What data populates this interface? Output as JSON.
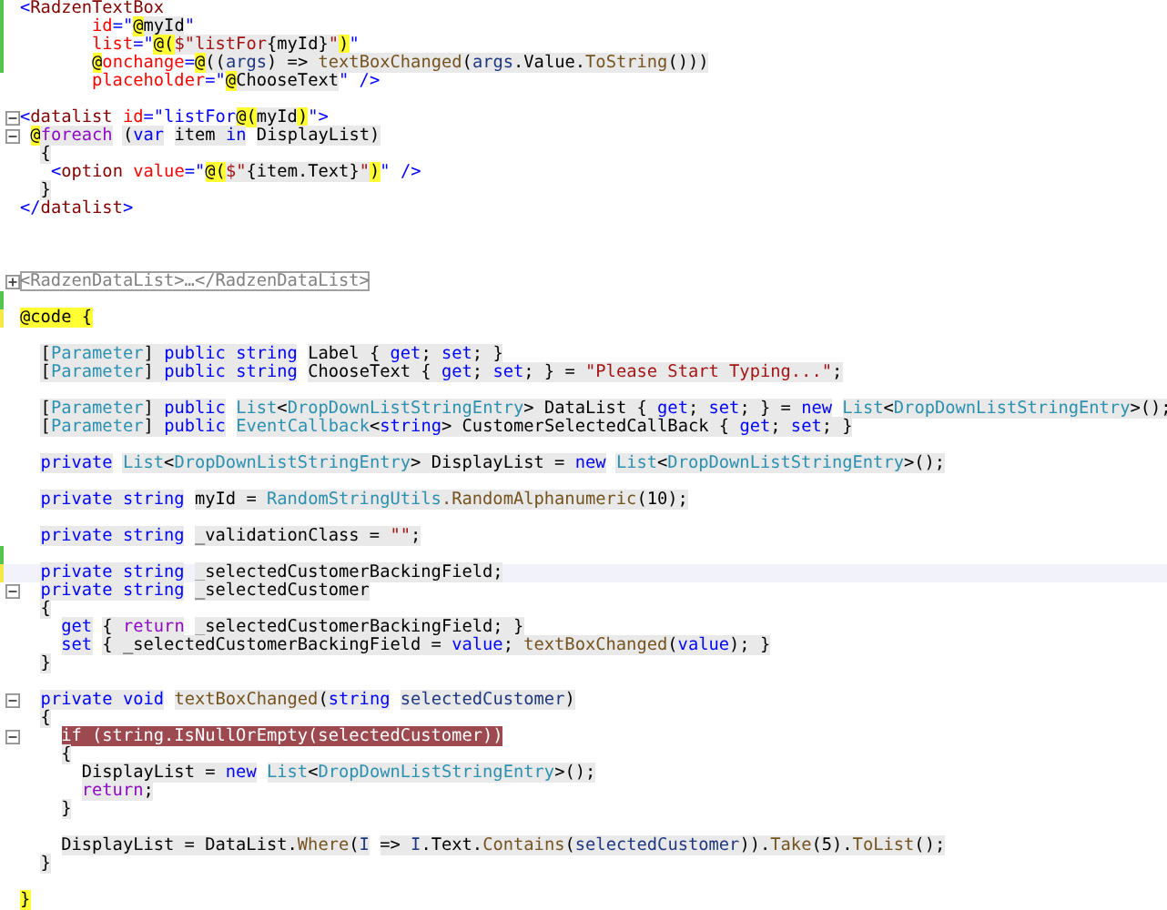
{
  "editor": {
    "lines": [
      {
        "modified": true,
        "saved": true,
        "tokens": [
          {
            "kind": "punct",
            "text": "<"
          },
          {
            "kind": "tag",
            "text": "RadzenTextBox"
          }
        ]
      },
      {
        "modified": true,
        "saved": true,
        "tokens": [
          {
            "kind": "attr",
            "text": "       id"
          },
          {
            "kind": "punct",
            "text": "=\""
          },
          {
            "kind": "razor",
            "text": "@"
          },
          {
            "kind": "plain",
            "text": "myId",
            "shaded": true
          },
          {
            "kind": "punct",
            "text": "\""
          }
        ]
      },
      {
        "modified": true,
        "saved": true,
        "tokens": [
          {
            "kind": "attr",
            "text": "       list"
          },
          {
            "kind": "punct",
            "text": "=\""
          },
          {
            "kind": "razor",
            "text": "@("
          },
          {
            "kind": "str",
            "text": "$\"listFor",
            "shaded": true
          },
          {
            "kind": "plain",
            "text": "{myId}",
            "shaded": true
          },
          {
            "kind": "str",
            "text": "\"",
            "shaded": true
          },
          {
            "kind": "razor",
            "text": ")"
          },
          {
            "kind": "punct",
            "text": "\""
          }
        ]
      },
      {
        "modified": true,
        "saved": true,
        "tokens": [
          {
            "kind": "razor",
            "text": "       @"
          },
          {
            "kind": "attr",
            "text": "onchange"
          },
          {
            "kind": "punct",
            "text": "="
          },
          {
            "kind": "razor",
            "text": "@"
          },
          {
            "kind": "plain",
            "text": "((",
            "shaded": true
          },
          {
            "kind": "param",
            "text": "args",
            "shaded": true
          },
          {
            "kind": "plain",
            "text": ") => ",
            "shaded": true
          },
          {
            "kind": "method",
            "text": "textBoxChanged",
            "shaded": true
          },
          {
            "kind": "plain",
            "text": "(",
            "shaded": true
          },
          {
            "kind": "param",
            "text": "args",
            "shaded": true
          },
          {
            "kind": "plain",
            "text": ".Value.",
            "shaded": true
          },
          {
            "kind": "method",
            "text": "ToString",
            "shaded": true
          },
          {
            "kind": "plain",
            "text": "()))",
            "shaded": true
          }
        ]
      },
      {
        "tokens": [
          {
            "kind": "attr",
            "text": "       placeholder"
          },
          {
            "kind": "punct",
            "text": "=\""
          },
          {
            "kind": "razor",
            "text": "@"
          },
          {
            "kind": "plain",
            "text": "ChooseText",
            "shaded": true
          },
          {
            "kind": "punct",
            "text": "\" />"
          }
        ]
      },
      {
        "blank": true
      },
      {
        "foldable": true,
        "collapsed": false,
        "tokens": [
          {
            "kind": "punct",
            "text": "<"
          },
          {
            "kind": "tag",
            "text": "datalist"
          },
          {
            "kind": "attr",
            "text": " id"
          },
          {
            "kind": "punct",
            "text": "=\"listFor"
          },
          {
            "kind": "razor",
            "text": "@("
          },
          {
            "kind": "plain",
            "text": "myId",
            "shaded": true
          },
          {
            "kind": "razor",
            "text": ")"
          },
          {
            "kind": "punct",
            "text": "\">"
          }
        ]
      },
      {
        "foldable": true,
        "collapsed": false,
        "tokens": [
          {
            "kind": "razor",
            "text": " @"
          },
          {
            "kind": "ctl",
            "text": "foreach",
            "shaded": true
          },
          {
            "kind": "plain",
            "text": " (",
            "shaded": true
          },
          {
            "kind": "kw",
            "text": "var",
            "shaded": true
          },
          {
            "kind": "plain",
            "text": " item ",
            "shaded": true
          },
          {
            "kind": "kw",
            "text": "in",
            "shaded": true
          },
          {
            "kind": "plain",
            "text": " DisplayList)",
            "shaded": true
          }
        ]
      },
      {
        "tokens": [
          {
            "kind": "plain",
            "text": "  {",
            "shaded": true
          }
        ]
      },
      {
        "tokens": [
          {
            "kind": "punct",
            "text": "   <"
          },
          {
            "kind": "tag",
            "text": "option"
          },
          {
            "kind": "attr",
            "text": " value"
          },
          {
            "kind": "punct",
            "text": "=\""
          },
          {
            "kind": "razor",
            "text": "@("
          },
          {
            "kind": "str",
            "text": "$\"",
            "shaded": true
          },
          {
            "kind": "plain",
            "text": "{item.Text}",
            "shaded": true
          },
          {
            "kind": "str",
            "text": "\"",
            "shaded": true
          },
          {
            "kind": "razor",
            "text": ")"
          },
          {
            "kind": "punct",
            "text": "\" />"
          }
        ]
      },
      {
        "tokens": [
          {
            "kind": "plain",
            "text": "  }",
            "shaded": true
          }
        ]
      },
      {
        "tokens": [
          {
            "kind": "punct",
            "text": "</"
          },
          {
            "kind": "tag",
            "text": "datalist"
          },
          {
            "kind": "punct",
            "text": ">"
          }
        ]
      },
      {
        "blank": true
      },
      {
        "blank": true
      },
      {
        "blank": true
      },
      {
        "foldable": true,
        "collapsed": true,
        "tokens": [
          {
            "kind": "collapsed",
            "text": "<RadzenDataList>…</RadzenDataList>"
          }
        ]
      },
      {
        "modified": true,
        "saved": true
      },
      {
        "modified": true,
        "saved": false,
        "tokens": [
          {
            "kind": "razor",
            "text": "@code {"
          }
        ]
      },
      {
        "blank": true
      },
      {
        "tokens": [
          {
            "kind": "plain",
            "text": "  [",
            "shaded": true
          },
          {
            "kind": "type",
            "text": "Parameter",
            "shaded": true
          },
          {
            "kind": "plain",
            "text": "] ",
            "shaded": true
          },
          {
            "kind": "kw",
            "text": "public string",
            "shaded": true
          },
          {
            "kind": "plain",
            "text": " Label { ",
            "shaded": true
          },
          {
            "kind": "kw",
            "text": "get",
            "shaded": true
          },
          {
            "kind": "plain",
            "text": "; ",
            "shaded": true
          },
          {
            "kind": "kw",
            "text": "set",
            "shaded": true
          },
          {
            "kind": "plain",
            "text": "; }",
            "shaded": true
          }
        ]
      },
      {
        "tokens": [
          {
            "kind": "plain",
            "text": "  [",
            "shaded": true
          },
          {
            "kind": "type",
            "text": "Parameter",
            "shaded": true
          },
          {
            "kind": "plain",
            "text": "] ",
            "shaded": true
          },
          {
            "kind": "kw",
            "text": "public string",
            "shaded": true
          },
          {
            "kind": "plain",
            "text": " ChooseText { ",
            "shaded": true
          },
          {
            "kind": "kw",
            "text": "get",
            "shaded": true
          },
          {
            "kind": "plain",
            "text": "; ",
            "shaded": true
          },
          {
            "kind": "kw",
            "text": "set",
            "shaded": true
          },
          {
            "kind": "plain",
            "text": "; } = ",
            "shaded": true
          },
          {
            "kind": "str",
            "text": "\"Please Start Typing...\"",
            "shaded": true
          },
          {
            "kind": "plain",
            "text": ";",
            "shaded": true
          }
        ]
      },
      {
        "blank": true
      },
      {
        "tokens": [
          {
            "kind": "plain",
            "text": "  [",
            "shaded": true
          },
          {
            "kind": "type",
            "text": "Parameter",
            "shaded": true
          },
          {
            "kind": "plain",
            "text": "] ",
            "shaded": true
          },
          {
            "kind": "kw",
            "text": "public",
            "shaded": true
          },
          {
            "kind": "type",
            "text": " List",
            "shaded": true
          },
          {
            "kind": "plain",
            "text": "<",
            "shaded": true
          },
          {
            "kind": "type",
            "text": "DropDownListStringEntry",
            "shaded": true
          },
          {
            "kind": "plain",
            "text": "> DataList { ",
            "shaded": true
          },
          {
            "kind": "kw",
            "text": "get",
            "shaded": true
          },
          {
            "kind": "plain",
            "text": "; ",
            "shaded": true
          },
          {
            "kind": "kw",
            "text": "set",
            "shaded": true
          },
          {
            "kind": "plain",
            "text": "; } = ",
            "shaded": true
          },
          {
            "kind": "kw",
            "text": "new",
            "shaded": true
          },
          {
            "kind": "type",
            "text": " List",
            "shaded": true
          },
          {
            "kind": "plain",
            "text": "<",
            "shaded": true
          },
          {
            "kind": "type",
            "text": "DropDownListStringEntry",
            "shaded": true
          },
          {
            "kind": "plain",
            "text": ">();",
            "shaded": true
          }
        ]
      },
      {
        "tokens": [
          {
            "kind": "plain",
            "text": "  [",
            "shaded": true
          },
          {
            "kind": "type",
            "text": "Parameter",
            "shaded": true
          },
          {
            "kind": "plain",
            "text": "] ",
            "shaded": true
          },
          {
            "kind": "kw",
            "text": "public",
            "shaded": true
          },
          {
            "kind": "type",
            "text": " EventCallback",
            "shaded": true
          },
          {
            "kind": "plain",
            "text": "<",
            "shaded": true
          },
          {
            "kind": "kw",
            "text": "string",
            "shaded": true
          },
          {
            "kind": "plain",
            "text": "> CustomerSelectedCallBack { ",
            "shaded": true
          },
          {
            "kind": "kw",
            "text": "get",
            "shaded": true
          },
          {
            "kind": "plain",
            "text": "; ",
            "shaded": true
          },
          {
            "kind": "kw",
            "text": "set",
            "shaded": true
          },
          {
            "kind": "plain",
            "text": "; }",
            "shaded": true
          }
        ]
      },
      {
        "blank": true
      },
      {
        "tokens": [
          {
            "kind": "kw",
            "text": "  private",
            "shaded": true
          },
          {
            "kind": "type",
            "text": " List",
            "shaded": true
          },
          {
            "kind": "plain",
            "text": "<",
            "shaded": true
          },
          {
            "kind": "type",
            "text": "DropDownListStringEntry",
            "shaded": true
          },
          {
            "kind": "plain",
            "text": "> DisplayList = ",
            "shaded": true
          },
          {
            "kind": "kw",
            "text": "new",
            "shaded": true
          },
          {
            "kind": "type",
            "text": " List",
            "shaded": true
          },
          {
            "kind": "plain",
            "text": "<",
            "shaded": true
          },
          {
            "kind": "type",
            "text": "DropDownListStringEntry",
            "shaded": true
          },
          {
            "kind": "plain",
            "text": ">();",
            "shaded": true
          }
        ]
      },
      {
        "blank": true
      },
      {
        "tokens": [
          {
            "kind": "kw",
            "text": "  private string",
            "shaded": true
          },
          {
            "kind": "plain",
            "text": " myId = ",
            "shaded": true
          },
          {
            "kind": "type",
            "text": "RandomStringUtils",
            "shaded": true
          },
          {
            "kind": "method",
            "text": ".RandomAlphanumeric",
            "shaded": true
          },
          {
            "kind": "plain",
            "text": "(10);",
            "shaded": true
          }
        ]
      },
      {
        "blank": true
      },
      {
        "tokens": [
          {
            "kind": "kw",
            "text": "  private string",
            "shaded": true
          },
          {
            "kind": "plain",
            "text": " _validationClass = ",
            "shaded": true
          },
          {
            "kind": "str",
            "text": "\"\"",
            "shaded": true
          },
          {
            "kind": "plain",
            "text": ";",
            "shaded": true
          }
        ]
      },
      {
        "modified": true,
        "saved": true
      },
      {
        "modified": true,
        "saved": false,
        "current": true,
        "tokens": [
          {
            "kind": "kw",
            "text": "  private string",
            "shaded": true
          },
          {
            "kind": "plain",
            "text": " _selectedCustomerBackingField;",
            "shaded": true
          }
        ]
      },
      {
        "foldable": true,
        "collapsed": false,
        "tokens": [
          {
            "kind": "kw",
            "text": "  private string",
            "shaded": true
          },
          {
            "kind": "plain",
            "text": " _selectedCustomer",
            "shaded": true
          }
        ]
      },
      {
        "tokens": [
          {
            "kind": "plain",
            "text": "  {",
            "shaded": true
          }
        ]
      },
      {
        "tokens": [
          {
            "kind": "kw",
            "text": "    get",
            "shaded": true
          },
          {
            "kind": "plain",
            "text": " { ",
            "shaded": true
          },
          {
            "kind": "ctl",
            "text": "return",
            "shaded": true
          },
          {
            "kind": "plain",
            "text": " _selectedCustomerBackingField; }",
            "shaded": true
          }
        ]
      },
      {
        "tokens": [
          {
            "kind": "kw",
            "text": "    set",
            "shaded": true
          },
          {
            "kind": "plain",
            "text": " { _selectedCustomerBackingField = ",
            "shaded": true
          },
          {
            "kind": "kw",
            "text": "value",
            "shaded": true
          },
          {
            "kind": "plain",
            "text": "; ",
            "shaded": true
          },
          {
            "kind": "method",
            "text": "textBoxChanged",
            "shaded": true
          },
          {
            "kind": "plain",
            "text": "(",
            "shaded": true
          },
          {
            "kind": "kw",
            "text": "value",
            "shaded": true
          },
          {
            "kind": "plain",
            "text": "); }",
            "shaded": true
          }
        ]
      },
      {
        "tokens": [
          {
            "kind": "plain",
            "text": "  }",
            "shaded": true
          }
        ]
      },
      {
        "blank": true
      },
      {
        "foldable": true,
        "collapsed": false,
        "tokens": [
          {
            "kind": "kw",
            "text": "  private void",
            "shaded": true
          },
          {
            "kind": "method",
            "text": " textBoxChanged",
            "shaded": true
          },
          {
            "kind": "plain",
            "text": "(",
            "shaded": true
          },
          {
            "kind": "kw",
            "text": "string",
            "shaded": true
          },
          {
            "kind": "param",
            "text": " selectedCustomer",
            "shaded": true
          },
          {
            "kind": "plain",
            "text": ")",
            "shaded": true
          }
        ]
      },
      {
        "tokens": [
          {
            "kind": "plain",
            "text": "  {",
            "shaded": true
          }
        ]
      },
      {
        "foldable": true,
        "collapsed": false,
        "tokens": [
          {
            "kind": "hl",
            "text": "    if (string.IsNullOrEmpty(selectedCustomer))"
          }
        ]
      },
      {
        "tokens": [
          {
            "kind": "plain",
            "text": "    {",
            "shaded": true
          }
        ]
      },
      {
        "tokens": [
          {
            "kind": "plain",
            "text": "      DisplayList = ",
            "shaded": true
          },
          {
            "kind": "kw",
            "text": "new",
            "shaded": true
          },
          {
            "kind": "type",
            "text": " List",
            "shaded": true
          },
          {
            "kind": "plain",
            "text": "<",
            "shaded": true
          },
          {
            "kind": "type",
            "text": "DropDownListStringEntry",
            "shaded": true
          },
          {
            "kind": "plain",
            "text": ">();",
            "shaded": true
          }
        ]
      },
      {
        "tokens": [
          {
            "kind": "ctl",
            "text": "      return",
            "shaded": true
          },
          {
            "kind": "plain",
            "text": ";",
            "shaded": true
          }
        ]
      },
      {
        "tokens": [
          {
            "kind": "plain",
            "text": "    }",
            "shaded": true
          }
        ]
      },
      {
        "blank": true
      },
      {
        "tokens": [
          {
            "kind": "plain",
            "text": "    DisplayList = DataList.",
            "shaded": true
          },
          {
            "kind": "method",
            "text": "Where",
            "shaded": true
          },
          {
            "kind": "plain",
            "text": "(",
            "shaded": true
          },
          {
            "kind": "param",
            "text": "I",
            "shaded": true
          },
          {
            "kind": "plain",
            "text": " => ",
            "shaded": true
          },
          {
            "kind": "param",
            "text": "I",
            "shaded": true
          },
          {
            "kind": "plain",
            "text": ".Text.",
            "shaded": true
          },
          {
            "kind": "method",
            "text": "Contains",
            "shaded": true
          },
          {
            "kind": "plain",
            "text": "(",
            "shaded": true
          },
          {
            "kind": "param",
            "text": "selectedCustomer",
            "shaded": true
          },
          {
            "kind": "plain",
            "text": ")).",
            "shaded": true
          },
          {
            "kind": "method",
            "text": "Take",
            "shaded": true
          },
          {
            "kind": "plain",
            "text": "(5).",
            "shaded": true
          },
          {
            "kind": "method",
            "text": "ToList",
            "shaded": true
          },
          {
            "kind": "plain",
            "text": "();",
            "shaded": true
          }
        ]
      },
      {
        "tokens": [
          {
            "kind": "plain",
            "text": "  }",
            "shaded": true
          }
        ]
      },
      {
        "blank": true
      },
      {
        "tokens": [
          {
            "kind": "razor",
            "text": "}"
          }
        ]
      }
    ]
  }
}
